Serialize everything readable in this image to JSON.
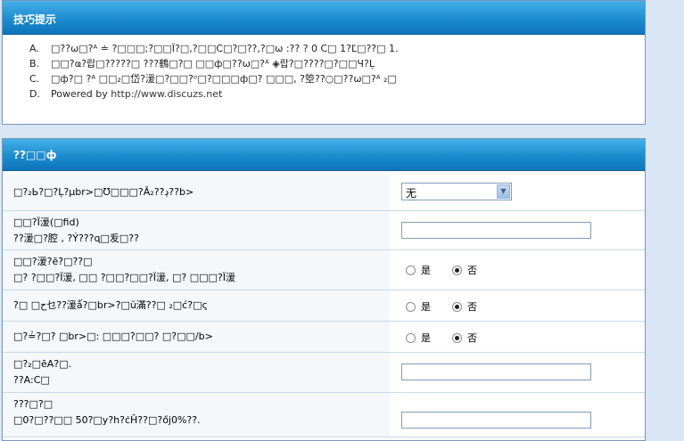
{
  "tips": {
    "title": "技巧提示",
    "items": [
      {
        "mark": "A.",
        "text": "□??ω□?ᴬ  ≐ ?□□□;?□□Ï?□,?□□C□?□??,?□ω  :?? ?   0 C□ 1?Ľ□??□ 1."
      },
      {
        "mark": "B.",
        "text": "□□?ҩ?랍□?????□   ???鶴□?□   □□ф□??ω□?ᴬ  ◈랍?□????□?□□Ч?Ļ"
      },
      {
        "mark": "C.",
        "text": "□ф?□   ?ᴬ   □□₂□岱?湲□?□□?ᵒ□?□□□ф□?   □□□, ?箜??○□??ω□?ᴬ   ₂□"
      },
      {
        "mark": "D.",
        "text": "Powered by ",
        "link": "http://www.discuzs.net"
      }
    ]
  },
  "settings": {
    "title": "??□□ф",
    "rows": [
      {
        "label": "□?₂Ь?□?Ļ?µbr>□Ʊ□□□?Ǎڍ??₂??b>",
        "control": "select",
        "value": "无"
      },
      {
        "label": "□□?Ï湲(□fid)",
        "desc": "??湲□?腔 , ?Ý???ɋ□叐□??",
        "control": "text",
        "value": ""
      },
      {
        "label": "□□?湲?ē?□??□",
        "desc": "□?   ?□□?Ï湲, □□ ?□□?□□?Ï湲, □?    □□□?Ï湲",
        "control": "radio",
        "yes": "是",
        "no": "否",
        "selected": "no"
      },
      {
        "label": "?□      □ح乜??湲ǻ?□br>?□ŭ滿??□    ₂□ć?□ς",
        "control": "radio",
        "yes": "是",
        "no": "否",
        "selected": "no"
      },
      {
        "label": "□?≟?□?    □br>□: □□□?□□?    □?□□/b>",
        "control": "radio",
        "yes": "是",
        "no": "否",
        "selected": "no"
      },
      {
        "label": "□?₂□ēA?□.",
        "desc": "??A:C□",
        "control": "text",
        "value": ""
      },
      {
        "label": "???□?□",
        "desc": "□0?□??□□ 50?□y?h?ċĤ??□?őj0%??.",
        "control": "text",
        "value": ""
      }
    ]
  }
}
